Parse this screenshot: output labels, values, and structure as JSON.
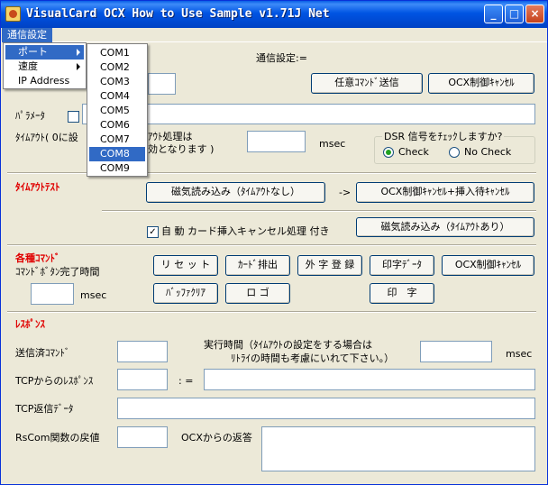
{
  "window": {
    "title": "VisualCard OCX How to Use Sample v1.71J Net"
  },
  "menu": {
    "settings": "通信設定"
  },
  "submenu": {
    "port": "ポート",
    "speed": "速度",
    "ip": "IP Address"
  },
  "ports": [
    "COM1",
    "COM2",
    "COM3",
    "COM4",
    "COM5",
    "COM6",
    "COM7",
    "COM8",
    "COM9"
  ],
  "labels": {
    "comm_setting": "通信設定:=",
    "param": "ﾊﾟﾗﾒｰﾀ",
    "timeout_prefix": "ﾀｲﾑｱｳﾄ( 0に設",
    "timeout_mid": "ｱｳﾄ処理は",
    "timeout_mid2": "効となります )",
    "msec": "msec",
    "timeout_test": "ﾀｲﾑｱｳﾄﾃｽﾄ",
    "arrow": "->",
    "auto_cancel": "自 動  カード挿入キャンセル処理 付き",
    "commands": "各種ｺﾏﾝﾄﾞ",
    "cmd_done_time": "ｺﾏﾝﾄﾞﾎﾞﾀﾝ完了時間",
    "response": "ﾚｽﾎﾟﾝｽ",
    "sent_cmd": "送信済ｺﾏﾝﾄﾞ",
    "exec_time": "実行時間（ﾀｲﾑｱｳﾄの設定をする場合は",
    "exec_time2": "ﾘﾄﾗｲの時間も考慮にいれて下さい。）",
    "tcp_response": "TCPからのﾚｽﾎﾟﾝｽ",
    "colon_eq": ": =",
    "tcp_return": "TCP返信ﾃﾞｰﾀ",
    "rscom_return": "RsCom関数の戻値",
    "ocx_return": "OCXからの返答"
  },
  "dsr": {
    "title": "DSR 信号をﾁｪｯｸしますか?",
    "check": "Check",
    "no_check": "No Check",
    "selected": "Check"
  },
  "buttons": {
    "custom_cmd": "任意ｺﾏﾝﾄﾞ送信",
    "ocx_cancel_top": "OCX制御ｷｬﾝｾﾙ",
    "mag_read_nt": "磁気読み込み（ﾀｲﾑｱｳﾄなし）",
    "ocx_cancel_insert": "OCX制御ｷｬﾝｾﾙ+挿入待ｷｬﾝｾﾙ",
    "mag_read_t": "磁気読み込み（ﾀｲﾑｱｳﾄあり）",
    "reset": "リ セ ッ ト",
    "eject": "ｶｰﾄﾞ排出",
    "ext_reg": "外 字 登 録",
    "print_data": "印字ﾃﾞｰﾀ",
    "ocx_cancel_cmd": "OCX制御ｷｬﾝｾﾙ",
    "buffer_clear": "ﾊﾞｯﾌｧｸﾘｱ",
    "logo": "ロ ゴ",
    "print": "印　字"
  },
  "colors": {
    "titlebar": "#0054e3",
    "accent_red": "#e00000",
    "menu_highlight": "#316ac5"
  }
}
